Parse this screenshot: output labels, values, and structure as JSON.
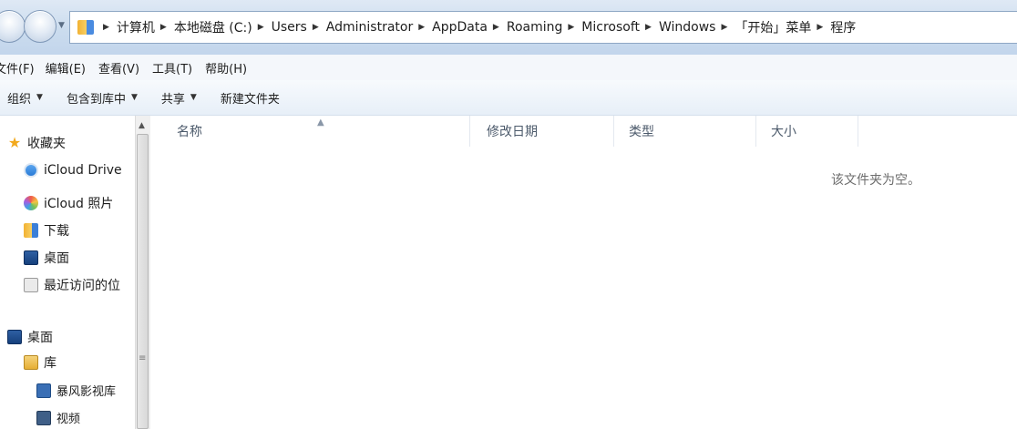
{
  "address_bar": {
    "path": [
      "计算机",
      "本地磁盘 (C:)",
      "Users",
      "Administrator",
      "AppData",
      "Roaming",
      "Microsoft",
      "Windows",
      "「开始」菜单",
      "程序"
    ]
  },
  "menu": {
    "file": "文件(F)",
    "edit": "编辑(E)",
    "view": "查看(V)",
    "tools": "工具(T)",
    "help": "帮助(H)"
  },
  "toolbar": {
    "organize": "组织",
    "include_library": "包含到库中",
    "share": "共享",
    "new_folder": "新建文件夹"
  },
  "nav_pane": {
    "favorites": "收藏夹",
    "icloud_drive": "iCloud Drive",
    "icloud_photos": "iCloud 照片",
    "downloads": "下载",
    "desktop_fav": "桌面",
    "recent": "最近访问的位",
    "desktop": "桌面",
    "libraries": "库",
    "storm_video_lib": "暴风影视库",
    "videos": "视频"
  },
  "file_list": {
    "columns": [
      "名称",
      "修改日期",
      "类型",
      "大小"
    ],
    "empty_message": "该文件夹为空。"
  },
  "icons": {
    "sort_indicator": "chevron-up-icon",
    "dropdown": "triangle-down-icon",
    "crumb_separator": "triangle-right-icon"
  }
}
